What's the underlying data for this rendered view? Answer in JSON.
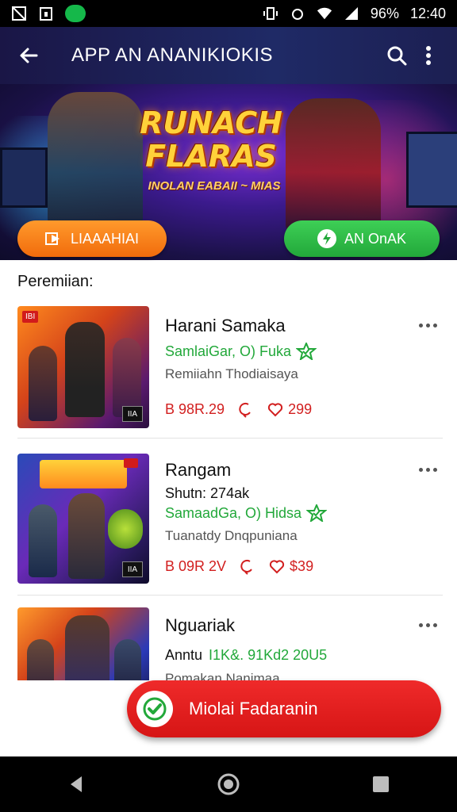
{
  "status_bar": {
    "battery": "96%",
    "time": "12:40"
  },
  "app_bar": {
    "title": "APP AN ANANIKIOKIS"
  },
  "banner": {
    "logo_line1": "RUNACH",
    "logo_line2": "FLARAS",
    "tagline": "INOLAN EABAII ~ MIAS",
    "left_button": "LIAAAHIAI",
    "right_button": "AN OnAK"
  },
  "section": {
    "title": "Peremiian:"
  },
  "cards": [
    {
      "badge": "IBI",
      "title": "Harani Samaka",
      "green": "SamlaiGar, O) Fuka",
      "subtitle": "Remiiahn Thodiaisaya",
      "price": "B 98R.29",
      "likes": "299",
      "corner": "IIA"
    },
    {
      "badge": "",
      "title": "Rangam",
      "line": "Shutn: 274ak",
      "green": "SamaadGa, O) Hidsa",
      "subtitle": "Tuanatdy Dnqpuniana",
      "price": "B 09R 2V",
      "likes": "$39",
      "corner": "IIA"
    },
    {
      "title": "Nguariak",
      "line_prefix": "Anntu",
      "green": "I1K&. 91Kd2 20U5",
      "subtitle": "Pomakan Nanimaa"
    }
  ],
  "fab": {
    "label": "Miolai Fadaranin"
  }
}
